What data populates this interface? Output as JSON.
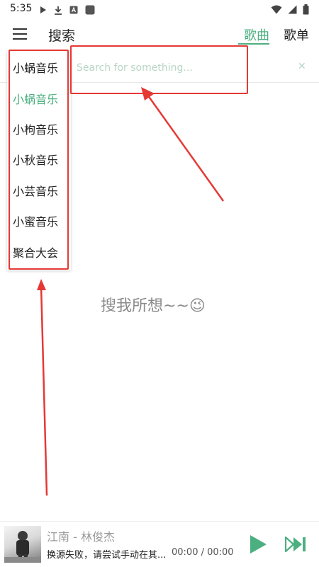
{
  "status_bar": {
    "time": "5:35",
    "left_icons": [
      "play-icon",
      "download-icon",
      "font-icon",
      "app-icon"
    ],
    "right_icons": [
      "wifi-icon",
      "signal-icon",
      "battery-icon"
    ]
  },
  "toolbar": {
    "title": "搜索",
    "tabs": [
      {
        "label": "歌曲",
        "active": true
      },
      {
        "label": "歌单",
        "active": false
      }
    ]
  },
  "search": {
    "placeholder": "Search for something..."
  },
  "source_dropdown": {
    "items": [
      {
        "label": "小蜗音乐",
        "active": false
      },
      {
        "label": "小蜗音乐",
        "active": true
      },
      {
        "label": "小枸音乐",
        "active": false
      },
      {
        "label": "小秋音乐",
        "active": false
      },
      {
        "label": "小芸音乐",
        "active": false
      },
      {
        "label": "小蜜音乐",
        "active": false
      },
      {
        "label": "聚合大会",
        "active": false
      }
    ]
  },
  "empty_state": {
    "text": "搜我所想~~😉"
  },
  "player": {
    "song": "江南 - 林俊杰",
    "status": "换源失败，请尝试手动在其...",
    "time": "00:00 / 00:00"
  },
  "colors": {
    "accent": "#4caf80",
    "annotation": "#e53935"
  }
}
